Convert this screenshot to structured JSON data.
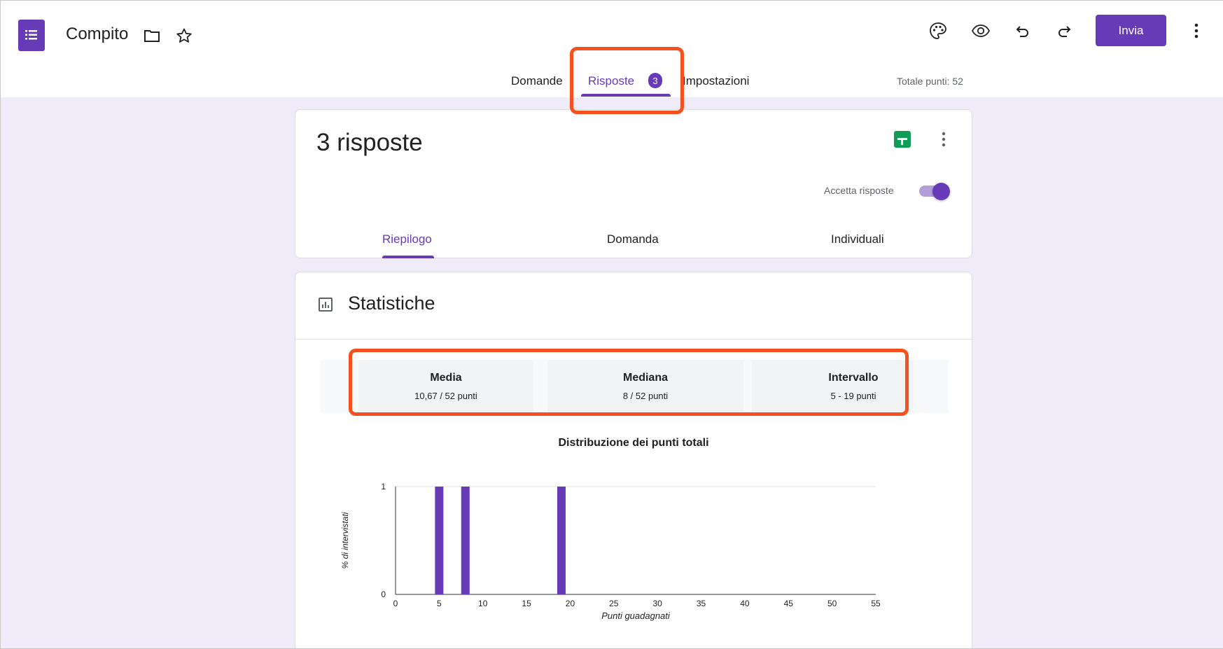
{
  "app": {
    "title": "Compito",
    "send_label": "Invia",
    "colors": {
      "accent": "#673ab7",
      "highlight": "#f4511e",
      "background": "#f0ebf8"
    }
  },
  "header": {
    "icons": [
      "forms-logo-icon",
      "folder-icon",
      "star-icon",
      "palette-icon",
      "eye-icon",
      "undo-icon",
      "redo-icon",
      "more-vert-icon"
    ]
  },
  "tabs": [
    {
      "label": "Domande",
      "active": false
    },
    {
      "label": "Risposte",
      "active": true,
      "badge": "3"
    },
    {
      "label": "Impostazioni",
      "active": false
    }
  ],
  "total_points": "Totale punti: 52",
  "responses": {
    "title": "3 risposte",
    "accept_label": "Accetta risposte",
    "accept_on": true,
    "sub_tabs": [
      {
        "label": "Riepilogo",
        "active": true
      },
      {
        "label": "Domanda",
        "active": false
      },
      {
        "label": "Individuali",
        "active": false
      }
    ]
  },
  "stats": {
    "title": "Statistiche",
    "items": [
      {
        "label": "Media",
        "value": "10,67 / 52 punti"
      },
      {
        "label": "Mediana",
        "value": "8 / 52 punti"
      },
      {
        "label": "Intervallo",
        "value": "5 - 19 punti"
      }
    ]
  },
  "chart_data": {
    "type": "bar",
    "title": "Distribuzione dei punti totali",
    "xlabel": "Punti guadagnati",
    "ylabel": "% di intervistati",
    "x": [
      5,
      8,
      19
    ],
    "values": [
      1,
      1,
      1
    ],
    "xlim": [
      0,
      55
    ],
    "ylim": [
      0,
      1
    ],
    "xticks": [
      "0",
      "5",
      "10",
      "15",
      "20",
      "25",
      "30",
      "35",
      "40",
      "45",
      "50",
      "55"
    ],
    "yticks": [
      "0",
      "1"
    ],
    "grid": true,
    "color": "#673ab7"
  }
}
